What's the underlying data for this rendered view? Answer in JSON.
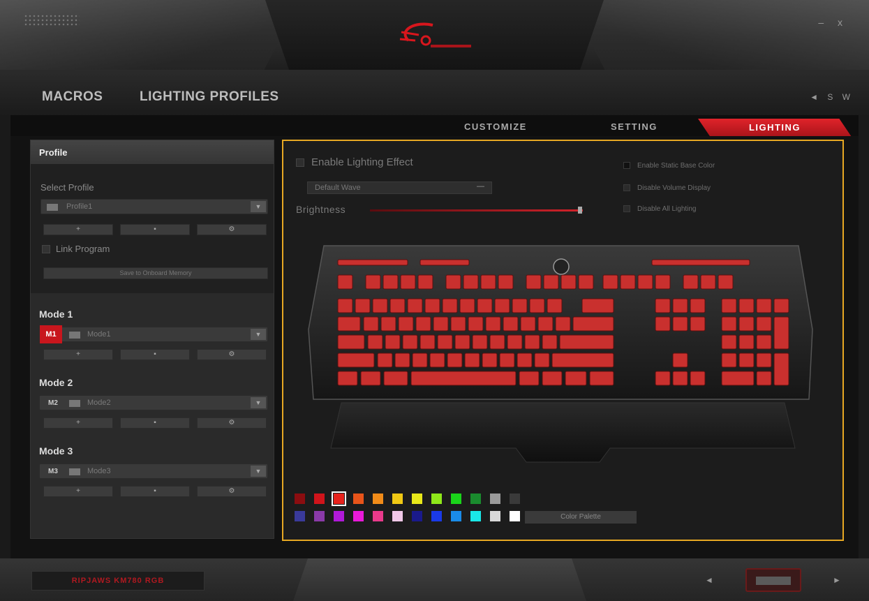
{
  "window": {
    "controls": "– x",
    "language": "◄ S W"
  },
  "nav": {
    "macros": "MACROS",
    "lighting_profiles": "LIGHTING PROFILES"
  },
  "tabs": {
    "customize": "CUSTOMIZE",
    "setting": "SETTING",
    "lighting": "LIGHTING"
  },
  "profile": {
    "header": "Profile",
    "select_label": "Select Profile",
    "selected": "Profile1",
    "link_program": "Link Program",
    "save_button": "Save to Onboard Memory",
    "add": "+",
    "settings": "⚙"
  },
  "modes": [
    {
      "title": "Mode 1",
      "badge": "M1",
      "name": "Mode1",
      "active": true
    },
    {
      "title": "Mode 2",
      "badge": "M2",
      "name": "Mode2",
      "active": false
    },
    {
      "title": "Mode 3",
      "badge": "M3",
      "name": "Mode3",
      "active": false
    }
  ],
  "lighting": {
    "enable_label": "Enable Lighting Effect",
    "effect": "Default Wave",
    "effect_dash": "—",
    "brightness_label": "Brightness",
    "brightness_level": 1.0,
    "options": [
      {
        "label": "Enable Static Base Color",
        "checked": true
      },
      {
        "label": "Disable Volume Display",
        "checked": false
      },
      {
        "label": "Disable All Lighting",
        "checked": false
      }
    ],
    "palette_row1": [
      "#8b0d10",
      "#d0141b",
      "#e8231d",
      "#e8541a",
      "#f08b19",
      "#f0c814",
      "#e8e81a",
      "#8fe81a",
      "#1ad41a",
      "#1a8b2e",
      "#9a9a9a",
      "#3a3a3a"
    ],
    "palette_row2": [
      "#3a3a9a",
      "#8a3aa8",
      "#b01ad8",
      "#e81ad8",
      "#e83a8b",
      "#f0c8e8",
      "#1a1a8b",
      "#1a3ae8",
      "#1a8be8",
      "#1ae8e8",
      "#d8d8d8",
      "#ffffff"
    ],
    "selected_swatch": 2,
    "palette_button": "Color Palette",
    "key_color": "#c9302e"
  },
  "footer": {
    "model": "RIPJAWS KM780 RGB",
    "prev": "◄",
    "next": "►"
  }
}
